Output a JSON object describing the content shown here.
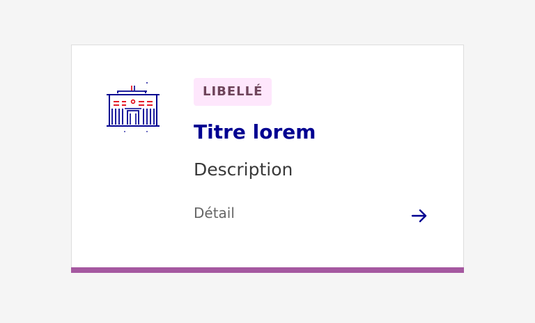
{
  "card": {
    "badge": "LIBELLÉ",
    "title": "Titre lorem",
    "description": "Description",
    "detail": "Détail",
    "pictogram": "city-hall-icon",
    "action_icon": "arrow-right-icon"
  },
  "colors": {
    "background": "#f5f5f5",
    "card_background": "#ffffff",
    "card_border": "#dddddd",
    "accent": "#a558a0",
    "badge_background": "#fee7fc",
    "badge_text": "#6e445a",
    "title": "#000091",
    "pictogram_red": "#e1000f"
  }
}
